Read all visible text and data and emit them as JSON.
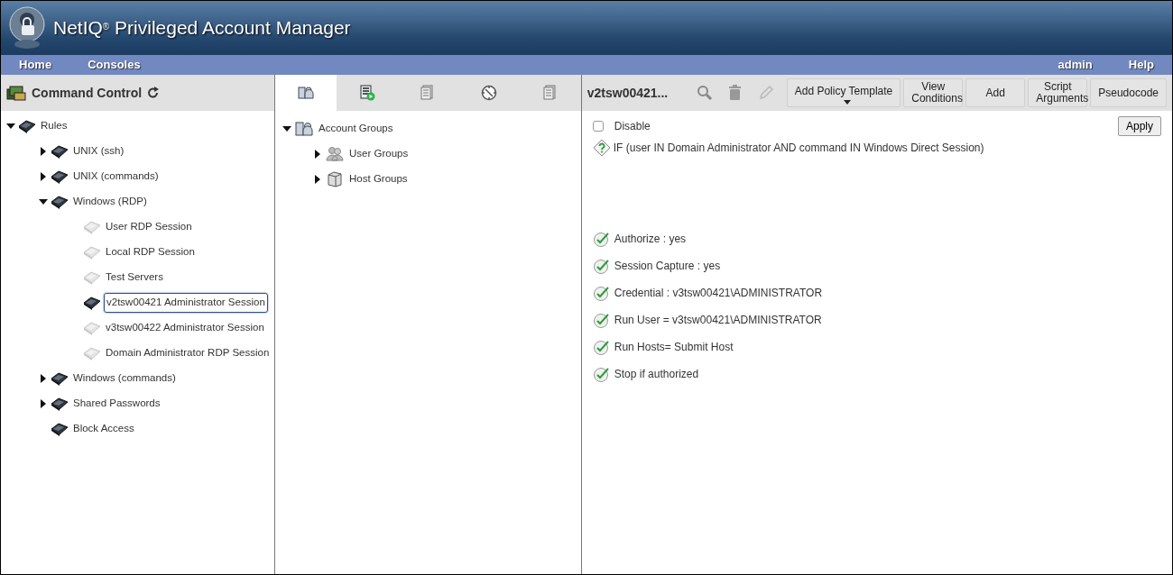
{
  "header": {
    "title": "NetIQ$^{®}$ Privileged Account Manager"
  },
  "nav": {
    "left": [
      "Home",
      "Consoles"
    ],
    "right": [
      "admin",
      "Help"
    ]
  },
  "left_panel": {
    "title": "Command Control",
    "tree": [
      {
        "label": "Rules",
        "enabled": true,
        "expanded": true,
        "selected": false,
        "children": [
          {
            "label": "UNIX (ssh)",
            "enabled": true,
            "expanded": false,
            "selected": false
          },
          {
            "label": "UNIX (commands)",
            "enabled": true,
            "expanded": false,
            "selected": false
          },
          {
            "label": "Windows (RDP)",
            "enabled": true,
            "expanded": true,
            "selected": false,
            "children": [
              {
                "label": "User RDP Session",
                "enabled": false,
                "selected": false
              },
              {
                "label": "Local RDP Session",
                "enabled": false,
                "selected": false
              },
              {
                "label": "Test Servers",
                "enabled": false,
                "selected": false
              },
              {
                "label": "v2tsw00421 Administrator Session",
                "enabled": true,
                "selected": true
              },
              {
                "label": "v3tsw00422 Administrator Session",
                "enabled": false,
                "selected": false
              },
              {
                "label": "Domain Administrator RDP Session",
                "enabled": false,
                "selected": false
              }
            ]
          },
          {
            "label": "Windows (commands)",
            "enabled": true,
            "expanded": false,
            "selected": false
          },
          {
            "label": "Shared Passwords",
            "enabled": true,
            "expanded": false,
            "selected": false
          },
          {
            "label": "Block Access",
            "enabled": true,
            "selected": false
          }
        ]
      }
    ]
  },
  "middle_panel": {
    "tabs": [
      {
        "selected": true
      },
      {
        "selected": false
      },
      {
        "selected": false
      },
      {
        "selected": false
      },
      {
        "selected": false
      }
    ],
    "tree": [
      {
        "label": "Account Groups",
        "expanded": true,
        "children": [
          {
            "label": "User Groups",
            "expanded": false
          },
          {
            "label": "Host Groups",
            "expanded": false
          }
        ]
      }
    ]
  },
  "right_panel": {
    "title": "v2tsw00421...",
    "tools": [
      {
        "disabled": false
      },
      {
        "disabled": false
      },
      {
        "disabled": true
      }
    ],
    "buttons": [
      {
        "label": "Add Policy Template",
        "dropdown": true
      },
      {
        "label": "View Conditions",
        "dropdown": false
      },
      {
        "label": "Add",
        "dropdown": false
      },
      {
        "label": "Script Arguments",
        "dropdown": false
      },
      {
        "label": "Pseudocode",
        "dropdown": false
      }
    ],
    "disable": {
      "label": "Disable",
      "checked": false
    },
    "apply": "Apply",
    "condition": "IF (user IN Domain Administrator AND command IN Windows Direct Session)",
    "actions": [
      "Authorize : yes",
      "Session Capture : yes",
      "Credential : v3tsw00421\\ADMINISTRATOR",
      "Run User = v3tsw00421\\ADMINISTRATOR",
      "Run Hosts= Submit Host",
      "Stop if authorized"
    ]
  }
}
